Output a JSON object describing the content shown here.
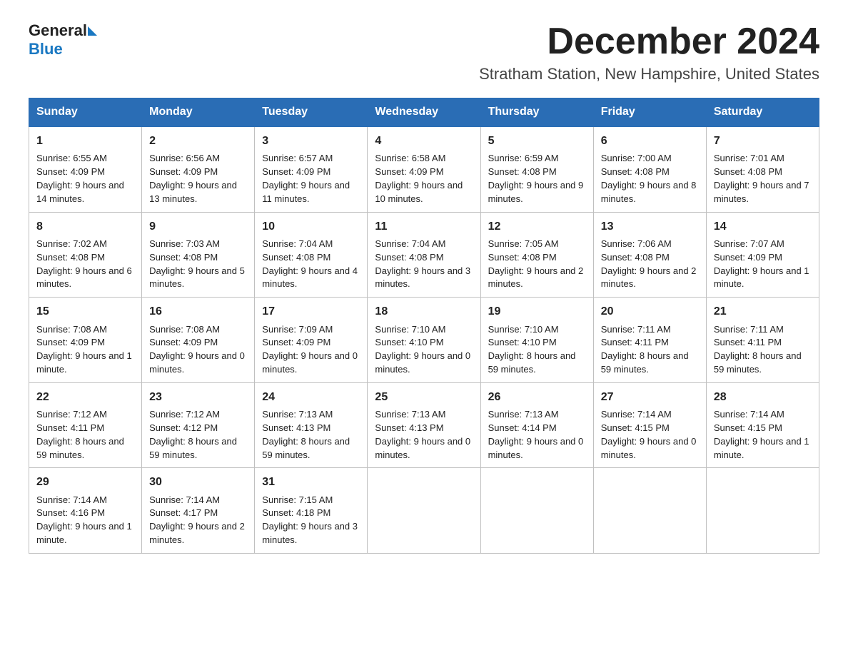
{
  "logo": {
    "general": "General",
    "blue": "Blue"
  },
  "header": {
    "month": "December 2024",
    "location": "Stratham Station, New Hampshire, United States"
  },
  "days_of_week": [
    "Sunday",
    "Monday",
    "Tuesday",
    "Wednesday",
    "Thursday",
    "Friday",
    "Saturday"
  ],
  "weeks": [
    [
      {
        "day": "1",
        "sunrise": "Sunrise: 6:55 AM",
        "sunset": "Sunset: 4:09 PM",
        "daylight": "Daylight: 9 hours and 14 minutes."
      },
      {
        "day": "2",
        "sunrise": "Sunrise: 6:56 AM",
        "sunset": "Sunset: 4:09 PM",
        "daylight": "Daylight: 9 hours and 13 minutes."
      },
      {
        "day": "3",
        "sunrise": "Sunrise: 6:57 AM",
        "sunset": "Sunset: 4:09 PM",
        "daylight": "Daylight: 9 hours and 11 minutes."
      },
      {
        "day": "4",
        "sunrise": "Sunrise: 6:58 AM",
        "sunset": "Sunset: 4:09 PM",
        "daylight": "Daylight: 9 hours and 10 minutes."
      },
      {
        "day": "5",
        "sunrise": "Sunrise: 6:59 AM",
        "sunset": "Sunset: 4:08 PM",
        "daylight": "Daylight: 9 hours and 9 minutes."
      },
      {
        "day": "6",
        "sunrise": "Sunrise: 7:00 AM",
        "sunset": "Sunset: 4:08 PM",
        "daylight": "Daylight: 9 hours and 8 minutes."
      },
      {
        "day": "7",
        "sunrise": "Sunrise: 7:01 AM",
        "sunset": "Sunset: 4:08 PM",
        "daylight": "Daylight: 9 hours and 7 minutes."
      }
    ],
    [
      {
        "day": "8",
        "sunrise": "Sunrise: 7:02 AM",
        "sunset": "Sunset: 4:08 PM",
        "daylight": "Daylight: 9 hours and 6 minutes."
      },
      {
        "day": "9",
        "sunrise": "Sunrise: 7:03 AM",
        "sunset": "Sunset: 4:08 PM",
        "daylight": "Daylight: 9 hours and 5 minutes."
      },
      {
        "day": "10",
        "sunrise": "Sunrise: 7:04 AM",
        "sunset": "Sunset: 4:08 PM",
        "daylight": "Daylight: 9 hours and 4 minutes."
      },
      {
        "day": "11",
        "sunrise": "Sunrise: 7:04 AM",
        "sunset": "Sunset: 4:08 PM",
        "daylight": "Daylight: 9 hours and 3 minutes."
      },
      {
        "day": "12",
        "sunrise": "Sunrise: 7:05 AM",
        "sunset": "Sunset: 4:08 PM",
        "daylight": "Daylight: 9 hours and 2 minutes."
      },
      {
        "day": "13",
        "sunrise": "Sunrise: 7:06 AM",
        "sunset": "Sunset: 4:08 PM",
        "daylight": "Daylight: 9 hours and 2 minutes."
      },
      {
        "day": "14",
        "sunrise": "Sunrise: 7:07 AM",
        "sunset": "Sunset: 4:09 PM",
        "daylight": "Daylight: 9 hours and 1 minute."
      }
    ],
    [
      {
        "day": "15",
        "sunrise": "Sunrise: 7:08 AM",
        "sunset": "Sunset: 4:09 PM",
        "daylight": "Daylight: 9 hours and 1 minute."
      },
      {
        "day": "16",
        "sunrise": "Sunrise: 7:08 AM",
        "sunset": "Sunset: 4:09 PM",
        "daylight": "Daylight: 9 hours and 0 minutes."
      },
      {
        "day": "17",
        "sunrise": "Sunrise: 7:09 AM",
        "sunset": "Sunset: 4:09 PM",
        "daylight": "Daylight: 9 hours and 0 minutes."
      },
      {
        "day": "18",
        "sunrise": "Sunrise: 7:10 AM",
        "sunset": "Sunset: 4:10 PM",
        "daylight": "Daylight: 9 hours and 0 minutes."
      },
      {
        "day": "19",
        "sunrise": "Sunrise: 7:10 AM",
        "sunset": "Sunset: 4:10 PM",
        "daylight": "Daylight: 8 hours and 59 minutes."
      },
      {
        "day": "20",
        "sunrise": "Sunrise: 7:11 AM",
        "sunset": "Sunset: 4:11 PM",
        "daylight": "Daylight: 8 hours and 59 minutes."
      },
      {
        "day": "21",
        "sunrise": "Sunrise: 7:11 AM",
        "sunset": "Sunset: 4:11 PM",
        "daylight": "Daylight: 8 hours and 59 minutes."
      }
    ],
    [
      {
        "day": "22",
        "sunrise": "Sunrise: 7:12 AM",
        "sunset": "Sunset: 4:11 PM",
        "daylight": "Daylight: 8 hours and 59 minutes."
      },
      {
        "day": "23",
        "sunrise": "Sunrise: 7:12 AM",
        "sunset": "Sunset: 4:12 PM",
        "daylight": "Daylight: 8 hours and 59 minutes."
      },
      {
        "day": "24",
        "sunrise": "Sunrise: 7:13 AM",
        "sunset": "Sunset: 4:13 PM",
        "daylight": "Daylight: 8 hours and 59 minutes."
      },
      {
        "day": "25",
        "sunrise": "Sunrise: 7:13 AM",
        "sunset": "Sunset: 4:13 PM",
        "daylight": "Daylight: 9 hours and 0 minutes."
      },
      {
        "day": "26",
        "sunrise": "Sunrise: 7:13 AM",
        "sunset": "Sunset: 4:14 PM",
        "daylight": "Daylight: 9 hours and 0 minutes."
      },
      {
        "day": "27",
        "sunrise": "Sunrise: 7:14 AM",
        "sunset": "Sunset: 4:15 PM",
        "daylight": "Daylight: 9 hours and 0 minutes."
      },
      {
        "day": "28",
        "sunrise": "Sunrise: 7:14 AM",
        "sunset": "Sunset: 4:15 PM",
        "daylight": "Daylight: 9 hours and 1 minute."
      }
    ],
    [
      {
        "day": "29",
        "sunrise": "Sunrise: 7:14 AM",
        "sunset": "Sunset: 4:16 PM",
        "daylight": "Daylight: 9 hours and 1 minute."
      },
      {
        "day": "30",
        "sunrise": "Sunrise: 7:14 AM",
        "sunset": "Sunset: 4:17 PM",
        "daylight": "Daylight: 9 hours and 2 minutes."
      },
      {
        "day": "31",
        "sunrise": "Sunrise: 7:15 AM",
        "sunset": "Sunset: 4:18 PM",
        "daylight": "Daylight: 9 hours and 3 minutes."
      },
      null,
      null,
      null,
      null
    ]
  ]
}
